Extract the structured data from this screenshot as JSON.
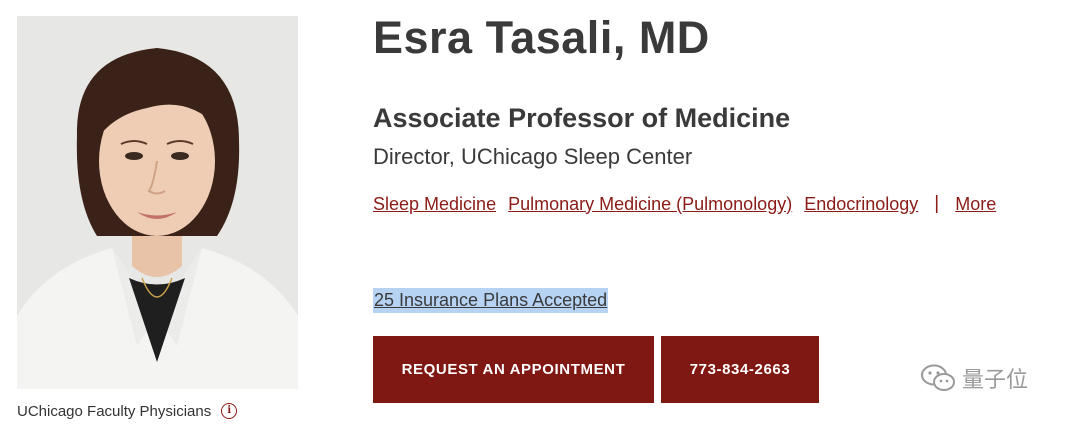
{
  "profile": {
    "name": "Esra Tasali, MD",
    "title": "Associate Professor of Medicine",
    "subtitle": "Director, UChicago Sleep Center",
    "affiliation": "UChicago Faculty Physicians",
    "affiliation_icon": "info-icon",
    "photo": "doctor-portrait"
  },
  "specialties": {
    "items": [
      "Sleep Medicine",
      "Pulmonary Medicine (Pulmonology)",
      "Endocrinology"
    ],
    "separator": "|",
    "more_label": "More"
  },
  "insurance": {
    "label": "25 Insurance Plans Accepted"
  },
  "actions": {
    "appointment_label": "REQUEST AN APPOINTMENT",
    "phone_label": "773-834-2663"
  },
  "watermark": {
    "text": "量子位",
    "icon": "wechat-icon"
  },
  "colors": {
    "brand": "#7f1712",
    "link": "#8a1b16",
    "highlight": "#b7d3f4",
    "text": "#3a3a3a"
  }
}
